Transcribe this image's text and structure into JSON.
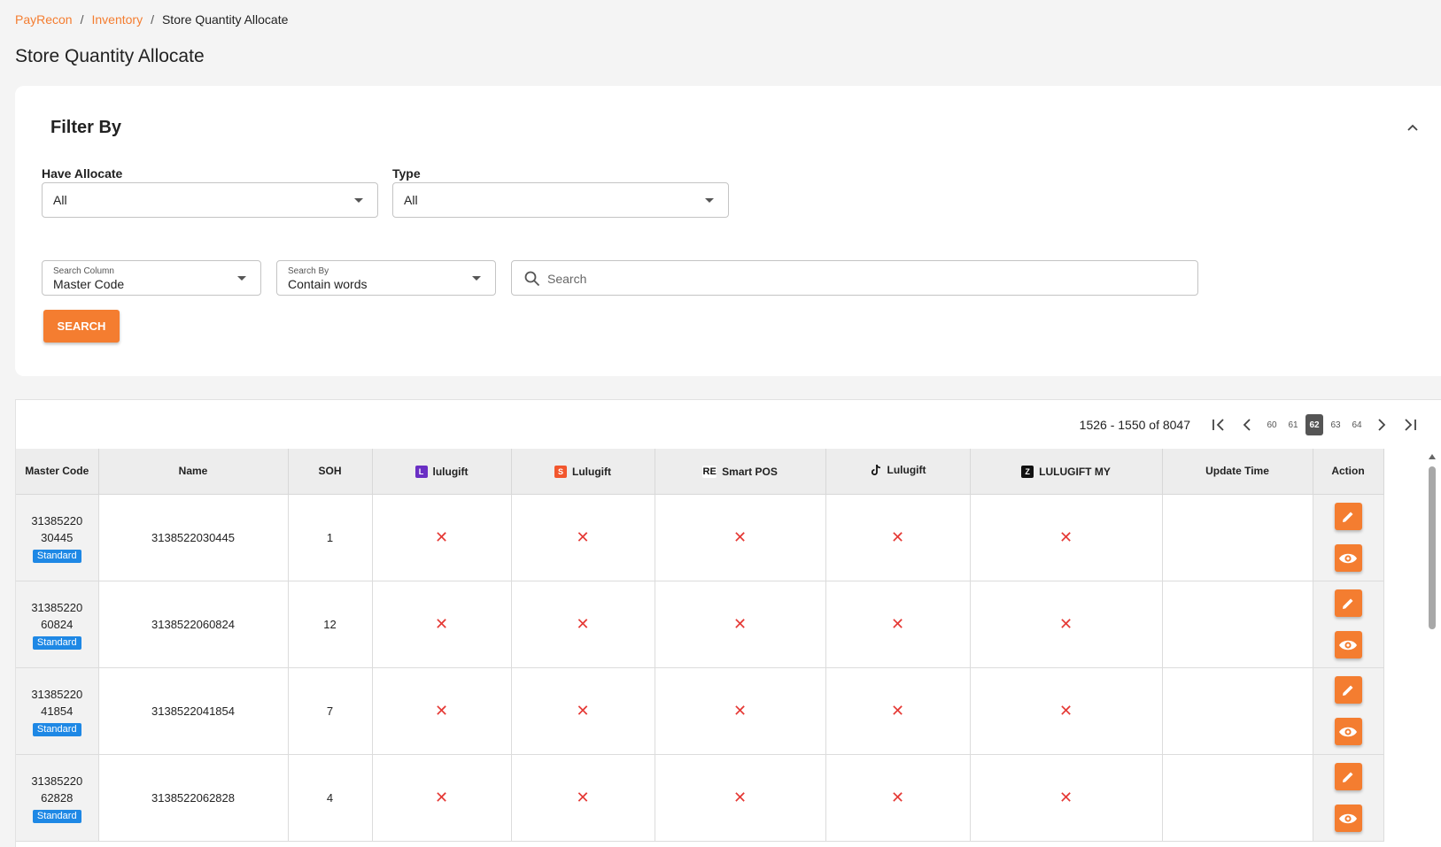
{
  "breadcrumb": {
    "home": "PayRecon",
    "section": "Inventory",
    "current": "Store Quantity Allocate"
  },
  "page_title": "Store Quantity Allocate",
  "filter": {
    "title": "Filter By",
    "have_allocate": {
      "label": "Have Allocate",
      "value": "All"
    },
    "type": {
      "label": "Type",
      "value": "All"
    },
    "search_column": {
      "label": "Search Column",
      "value": "Master Code"
    },
    "search_by": {
      "label": "Search By",
      "value": "Contain words"
    },
    "search_placeholder": "Search",
    "search_button": "SEARCH"
  },
  "pagination": {
    "range": "1526 - 1550 of 8047",
    "pages": [
      "60",
      "61",
      "62",
      "63",
      "64"
    ],
    "current": "62"
  },
  "table": {
    "headers": {
      "master_code": "Master Code",
      "name": "Name",
      "soh": "SOH",
      "ch1": "lulugift",
      "ch2": "Lulugift",
      "ch3": "Smart POS",
      "ch4": "Lulugift",
      "ch5": "LULUGIFT MY",
      "update_time": "Update Time",
      "action": "Action"
    },
    "channel_icons": [
      "lulugift-shop-icon",
      "shopee-icon",
      "smart-pos-icon",
      "tiktok-icon",
      "zalora-icon"
    ],
    "rows": [
      {
        "code_a": "31385220",
        "code_b": "30445",
        "badge": "Standard",
        "name": "3138522030445",
        "soh": "1",
        "update_time": ""
      },
      {
        "code_a": "31385220",
        "code_b": "60824",
        "badge": "Standard",
        "name": "3138522060824",
        "soh": "12",
        "update_time": ""
      },
      {
        "code_a": "31385220",
        "code_b": "41854",
        "badge": "Standard",
        "name": "3138522041854",
        "soh": "7",
        "update_time": ""
      },
      {
        "code_a": "31385220",
        "code_b": "62828",
        "badge": "Standard",
        "name": "3138522062828",
        "soh": "4",
        "update_time": ""
      }
    ],
    "not_allocated_mark": "✕"
  },
  "colors": {
    "accent": "#f47d30",
    "badge": "#1e88e5",
    "cross": "#e53935"
  }
}
